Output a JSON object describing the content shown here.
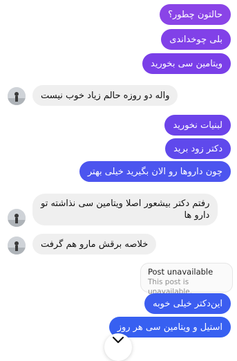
{
  "thread": {
    "messages": [
      {
        "side": "out",
        "text": "حالتون چطور؟"
      },
      {
        "side": "out",
        "text": "بلی چوخداندی"
      },
      {
        "side": "out",
        "text": "ویتامین سی بخورید"
      },
      {
        "side": "in",
        "text": "واله دو روزه حالم زیاد خوب نیست"
      },
      {
        "side": "out",
        "text": "لبنیات نخورید"
      },
      {
        "side": "out",
        "text": "دکتر زود برید"
      },
      {
        "side": "out",
        "text": "چون داروها رو الان بگیرید خیلی بهتر"
      },
      {
        "side": "in",
        "text_line1": "رفتم دکتر بیشعور اصلا ویتامین سی نذاشته تو",
        "text_line2": "دارو ها"
      },
      {
        "side": "in",
        "text": "خلاصه برقش مارو هم گرفت"
      },
      {
        "side": "out",
        "text": "این‌دکتر خیلی خوبه"
      },
      {
        "side": "out",
        "text": "استیل و  ویتامین سی هر روز"
      }
    ],
    "shared_post": {
      "title": "Post unavailable",
      "subtitle": "This post is unavailable."
    }
  },
  "colors": {
    "outgoing_top": "#8b47e8",
    "outgoing_mid": "#6a3fe6",
    "outgoing_bottom": "#3c5cf0",
    "incoming": "#efefef"
  },
  "icons": {
    "scroll_down": "chevron-down-icon",
    "avatar": "avatar"
  }
}
